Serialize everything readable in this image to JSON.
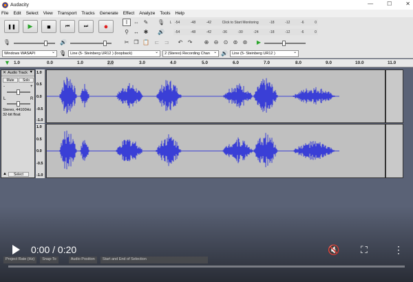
{
  "window": {
    "title": "Audacity",
    "minimize": "—",
    "maximize": "☐",
    "close": "✕"
  },
  "menu": [
    "File",
    "Edit",
    "Select",
    "View",
    "Transport",
    "Tracks",
    "Generate",
    "Effect",
    "Analyze",
    "Tools",
    "Help"
  ],
  "transport": {
    "pause": "❚❚",
    "play": "▶",
    "stop": "■",
    "skip_start": "⏮",
    "skip_end": "⏭",
    "record": "●"
  },
  "meter": {
    "record_scale": [
      "-54",
      "-48",
      "-42",
      "Click to Start Monitoring",
      "-18",
      "-12",
      "-6",
      "0"
    ],
    "play_scale": [
      "-54",
      "-48",
      "-42",
      "-36",
      "-30",
      "-24",
      "-18",
      "-12",
      "-6",
      "0"
    ],
    "lr_top": "L",
    "lr_bottom": "R"
  },
  "devices": {
    "host": "Windows WASAPI",
    "input": "Line (5- Steinberg UR12 ) (loopback)",
    "channels": "2 (Stereo) Recording Chan",
    "output": "Line (5- Steinberg UR12 )"
  },
  "ruler": {
    "marker": "1.0",
    "ticks": [
      "1.0",
      "0.0",
      "1.0",
      "2.0",
      "3.0",
      "4.0",
      "5.0",
      "6.0",
      "7.0",
      "8.0",
      "9.0",
      "10.0",
      "11.0"
    ]
  },
  "track": {
    "name": "Audio Track",
    "mute": "Mute",
    "solo": "Solo",
    "gain_minus": "-",
    "gain_plus": "+",
    "pan_l": "L",
    "pan_r": "R",
    "info_line1": "Stereo, 44100Hz",
    "info_line2": "32-bit float",
    "select": "Select",
    "scale": [
      "1.0",
      "0.5",
      "0.0",
      "-0.5",
      "-1.0"
    ]
  },
  "video": {
    "timecode": "0:00 / 0:20",
    "progress": 0.0
  },
  "status": {
    "project_rate": "Project Rate (Hz)",
    "snap_to": "Snap-To",
    "audio_position": "Audio Position",
    "selection": "Start and End of Selection"
  },
  "colors": {
    "wave": "#3a3fd6",
    "wave_bg": "#c0c0c0",
    "record": "#e02020",
    "play": "#2aa52a"
  }
}
